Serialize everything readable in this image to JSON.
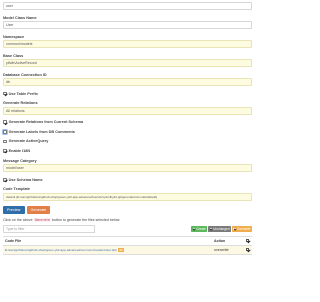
{
  "form": {
    "table_name_value": "user",
    "model_class_label": "Model Class Name",
    "model_class_value": "User",
    "namespace_label": "Namespace",
    "namespace_value": "common\\models",
    "base_class_label": "Base Class",
    "base_class_value": "yii\\db\\ActiveRecord",
    "db_connection_label": "Database Connection ID",
    "db_connection_value": "db",
    "use_table_prefix_label": "Use Table Prefix",
    "generate_relations_label": "Generate Relations",
    "generate_relations_value": "All relations",
    "relations_from_schema_label": "Generate Relations from Current Schema",
    "labels_from_db_label": "Generate Labels from DB Comments",
    "generate_activequery_label": "Generate ActiveQuery",
    "enable_i18n_label": "Enable I18N",
    "message_category_label": "Message Category",
    "message_category_value": "model/user",
    "use_schema_name_label": "Use Schema Name",
    "code_template_label": "Code Template",
    "code_template_value": "default (E:\\xampp\\htdocs\\github-shop\\green-yii2-app-advanced\\vendor\\yiisoft\\yii2-gii\\generators\\model/default)"
  },
  "buttons": {
    "preview": "Preview",
    "generate": "Generate"
  },
  "help": {
    "before": "Click on the above ",
    "code": "Generate",
    "after": " button to generate the files selected below:"
  },
  "filter": {
    "placeholder": "Type to filter",
    "tag_create": "Create",
    "tag_unchanged": "Unchanged",
    "tag_overwrite": "Overwrite"
  },
  "table": {
    "col_file": "Code File",
    "col_action": "Action",
    "rows": [
      {
        "file": "E:\\xampp\\htdocs\\github-shop\\green-yii2-app-advanced\\common\\models\\User.php",
        "badge": "diff",
        "action": "overwrite"
      }
    ]
  },
  "colors": {
    "preview_button": "#2f6ea8",
    "generate_button": "#e27f49",
    "sticky_field": "#fdfbe0",
    "create_tag": "#5cb85c",
    "unchanged_tag": "#7a7a7a",
    "overwrite_tag": "#f0ad4e"
  }
}
